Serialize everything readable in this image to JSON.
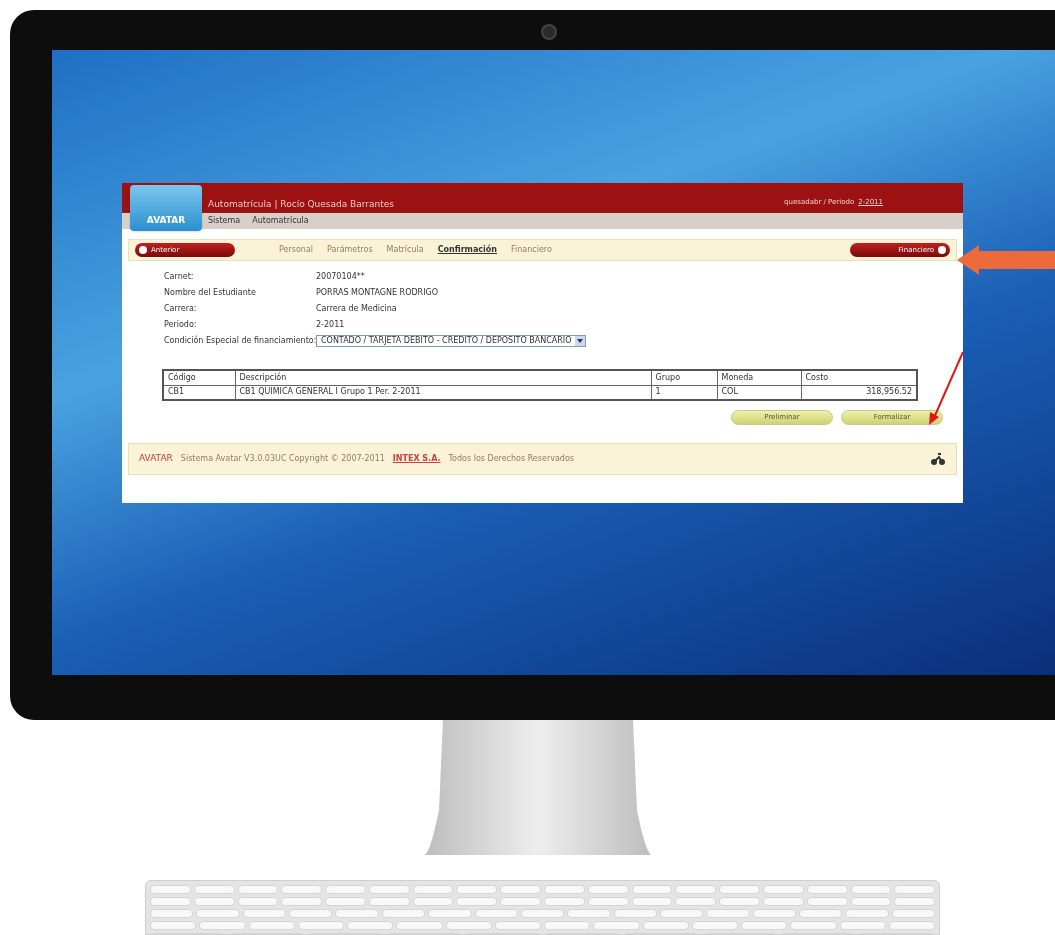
{
  "header": {
    "logo": "AVATAR",
    "title": "Automatrícula | Rocío Quesada Barrantes",
    "user": "quesadabr / Periodo",
    "period_link": "2-2011",
    "menu": [
      "Sistema",
      "Automatrícula"
    ]
  },
  "nav": {
    "prev_button": "Anterior",
    "next_button": "Financiero",
    "steps": [
      {
        "label": "Personal",
        "selected": false
      },
      {
        "label": "Parámetros",
        "selected": false
      },
      {
        "label": "Matrícula",
        "selected": false
      },
      {
        "label": "Confirmación",
        "selected": true
      },
      {
        "label": "Financiero",
        "selected": false
      }
    ]
  },
  "fields": [
    {
      "label": "Carnet:",
      "value": "20070104**"
    },
    {
      "label": "Nombre del Estudiante",
      "value": "PORRAS MONTAGNE RODRIGO"
    },
    {
      "label": "Carrera:",
      "value": "Carrera de Medicina"
    },
    {
      "label": "Periodo:",
      "value": "2-2011"
    }
  ],
  "financing": {
    "label": "Condición Especial de financiamiento:",
    "value": "CONTADO / TARJETA DEBITO - CREDITO / DEPOSITO BANCARIO"
  },
  "table": {
    "columns": [
      "Código",
      "Descripción",
      "Grupo",
      "Moneda",
      "Costo"
    ],
    "rows": [
      [
        "CB1",
        "CB1 QUIMICA GENERAL I Grupo 1 Per. 2-2011",
        "1",
        "COL",
        "318,956.52"
      ]
    ]
  },
  "buttons": [
    "Preliminar",
    "Formalizar"
  ],
  "footer": {
    "logo": "AVATAR",
    "text": "Sistema Avatar V3.0.03UC Copyright © 2007-2011",
    "link": "INTEX S.A.",
    "rights": "Todos los Derechos Reservados"
  }
}
